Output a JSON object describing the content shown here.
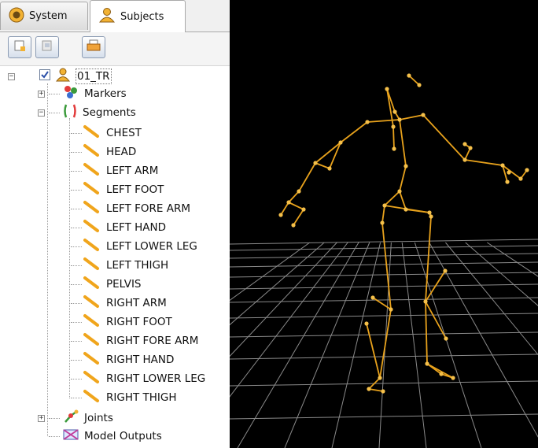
{
  "tabs": [
    {
      "label": "System",
      "icon": "system-icon",
      "active": false
    },
    {
      "label": "Subjects",
      "icon": "subjects-icon",
      "active": true
    }
  ],
  "toolbar": [
    {
      "icon": "new-subject-icon"
    },
    {
      "icon": "new-subject-from-template-icon"
    },
    {
      "icon": "save-subject-icon"
    }
  ],
  "tree": {
    "subject": {
      "label": "01_TR",
      "checked": true
    },
    "markers": {
      "label": "Markers"
    },
    "segments": {
      "label": "Segments",
      "items": [
        "CHEST",
        "HEAD",
        "LEFT ARM",
        "LEFT FOOT",
        "LEFT FORE ARM",
        "LEFT HAND",
        "LEFT LOWER LEG",
        "LEFT THIGH",
        "PELVIS",
        "RIGHT ARM",
        "RIGHT FOOT",
        "RIGHT FORE ARM",
        "RIGHT HAND",
        "RIGHT LOWER LEG",
        "RIGHT THIGH"
      ]
    },
    "joints": {
      "label": "Joints"
    },
    "model_outputs": {
      "label": "Model Outputs"
    }
  },
  "colors": {
    "skeleton": "#e8a21c",
    "segment_icon": "#f0a51c",
    "grid": "#8a8a8a",
    "viewport_bg": "#000000"
  }
}
